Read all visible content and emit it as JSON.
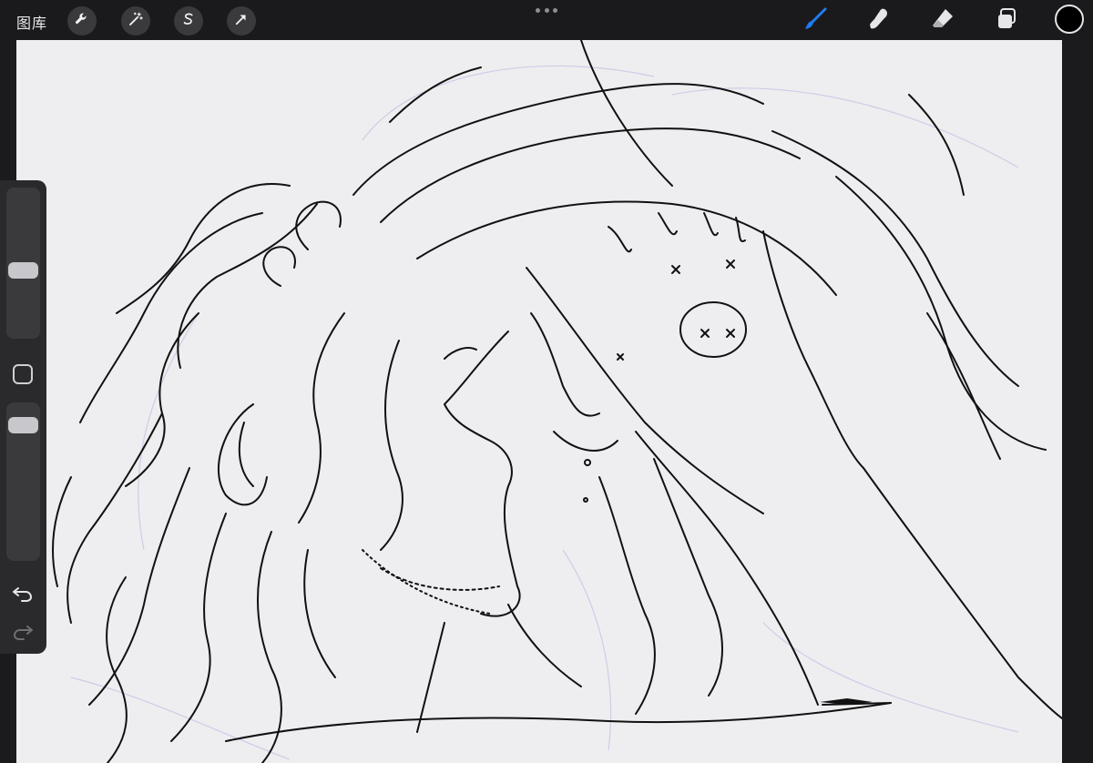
{
  "topbar": {
    "gallery_label": "图库",
    "left_tools": [
      {
        "name": "actions",
        "icon": "wrench-icon"
      },
      {
        "name": "adjustments",
        "icon": "magic-wand-icon"
      },
      {
        "name": "selection",
        "icon": "selection-s-icon"
      },
      {
        "name": "transform",
        "icon": "arrow-cursor-icon"
      }
    ],
    "more_icon": "more-dots-icon",
    "right_tools": [
      {
        "name": "brush",
        "icon": "brush-icon",
        "active": true
      },
      {
        "name": "smudge",
        "icon": "smudge-finger-icon",
        "active": false
      },
      {
        "name": "eraser",
        "icon": "eraser-icon",
        "active": false
      },
      {
        "name": "layers",
        "icon": "layers-icon",
        "active": false
      }
    ],
    "current_color": "#000000",
    "active_tool_color": "#1e7cf2"
  },
  "sidebar": {
    "brush_size_level": 0.44,
    "opacity_level": 0.92,
    "modify_icon": "modify-square-icon",
    "undo_icon": "undo-icon",
    "redo_icon": "redo-icon"
  },
  "canvas": {
    "background": "#eeeef0",
    "content": "line-art-sketch"
  }
}
